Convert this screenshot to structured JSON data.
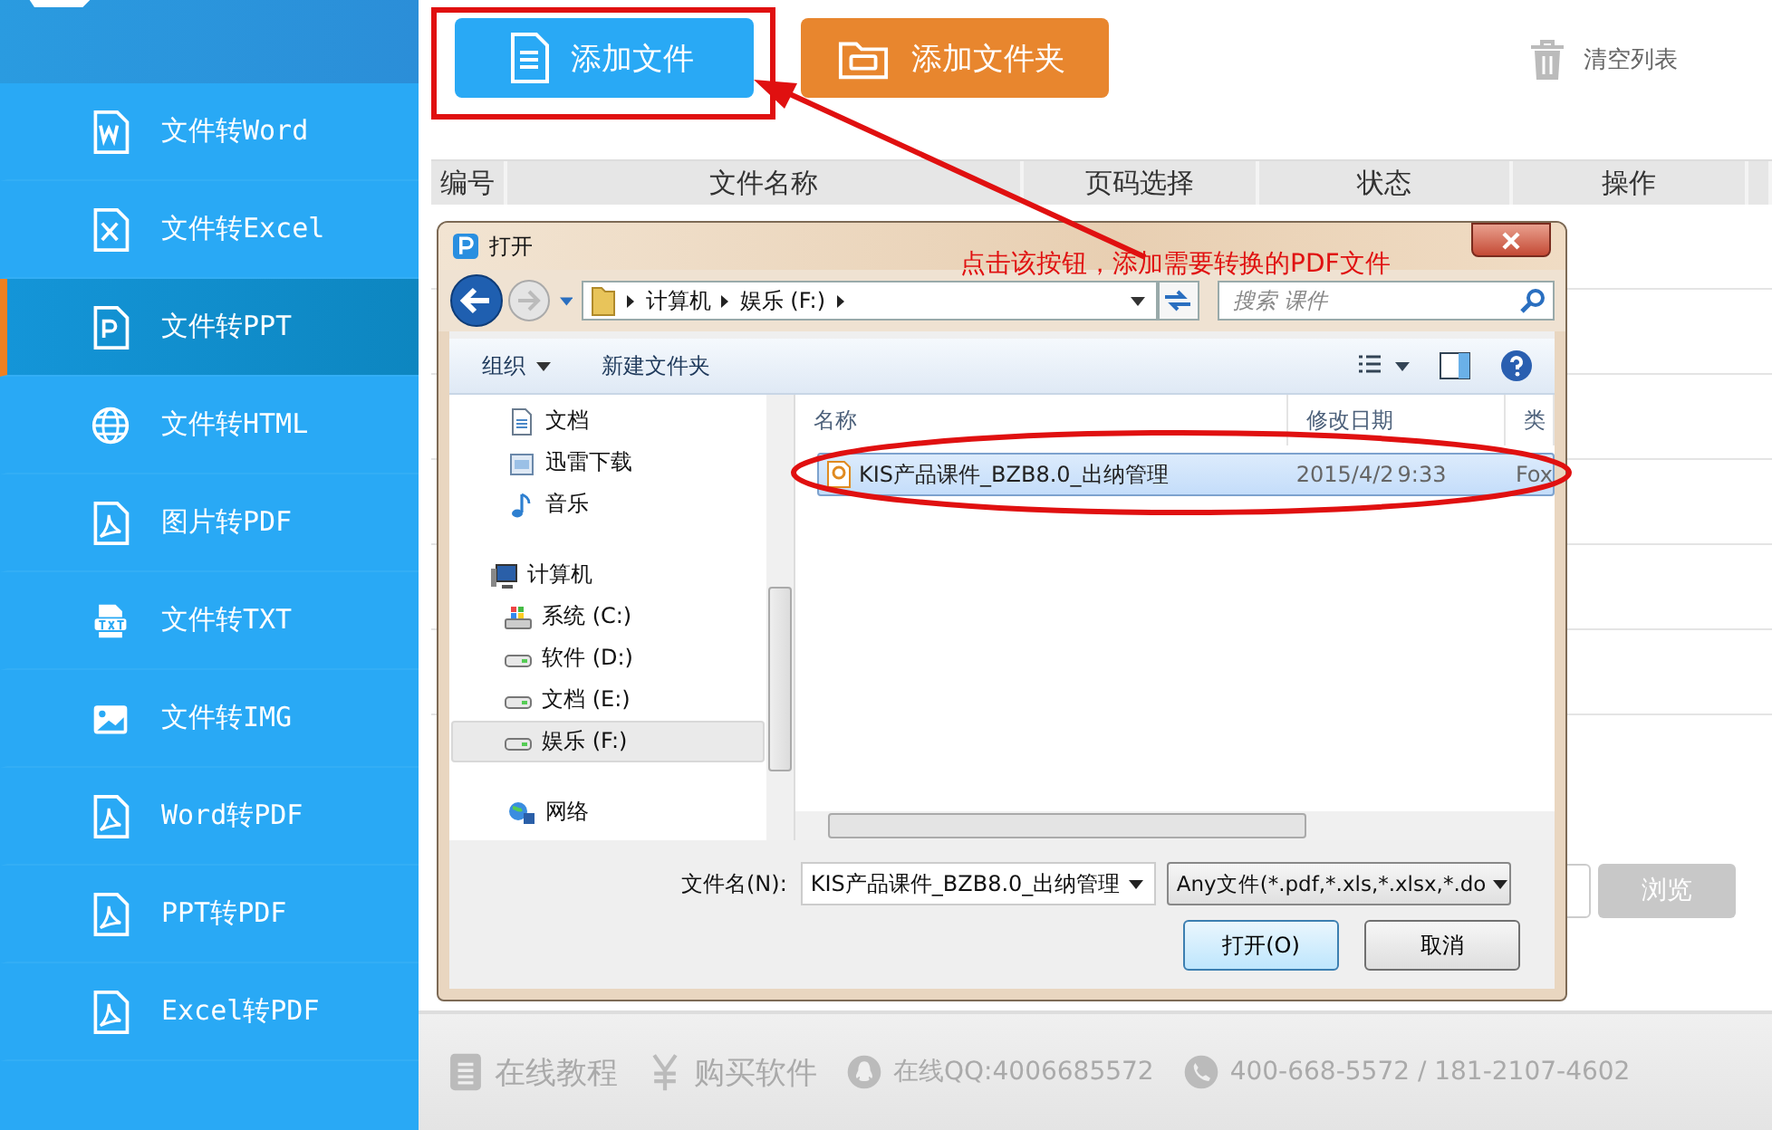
{
  "sidebar": {
    "items": [
      {
        "label": "文件转Word",
        "kind": "word",
        "selected": false
      },
      {
        "label": "文件转Excel",
        "kind": "excel",
        "selected": false
      },
      {
        "label": "文件转PPT",
        "kind": "ppt",
        "selected": true
      },
      {
        "label": "文件转HTML",
        "kind": "html",
        "selected": false
      },
      {
        "label": "图片转PDF",
        "kind": "pdf",
        "selected": false
      },
      {
        "label": "文件转TXT",
        "kind": "txt",
        "selected": false
      },
      {
        "label": "文件转IMG",
        "kind": "img",
        "selected": false
      },
      {
        "label": "Word转PDF",
        "kind": "pdf",
        "selected": false
      },
      {
        "label": "PPT转PDF",
        "kind": "pdf",
        "selected": false
      },
      {
        "label": "Excel转PDF",
        "kind": "pdf",
        "selected": false
      }
    ]
  },
  "toolbar": {
    "add_file": "添加文件",
    "add_folder": "添加文件夹",
    "clear_list": "清空列表"
  },
  "table": {
    "columns": [
      "编号",
      "文件名称",
      "页码选择",
      "状态",
      "操作"
    ]
  },
  "browse_button": "浏览",
  "footer": {
    "items": [
      {
        "kind": "tutorial",
        "label": "在线教程"
      },
      {
        "kind": "buy",
        "label": "购买软件"
      },
      {
        "kind": "qq",
        "label": "在线QQ:4006685572"
      },
      {
        "kind": "phone",
        "label": "400-668-5572 / 181-2107-4602"
      }
    ]
  },
  "annotation": "点击该按钮，添加需要转换的PDF文件",
  "dialog": {
    "title": "打开",
    "breadcrumb": [
      "计算机",
      "娱乐 (F:)"
    ],
    "search": {
      "placeholder": "搜索 课件"
    },
    "toolbar": {
      "organize": "组织",
      "new_folder": "新建文件夹"
    },
    "nav_tree": [
      {
        "label": "文档",
        "kind": "document",
        "selected": false
      },
      {
        "label": "迅雷下载",
        "kind": "download",
        "selected": false
      },
      {
        "label": "音乐",
        "kind": "music",
        "selected": false
      },
      {
        "label": "计算机",
        "kind": "computer",
        "selected": false,
        "children": [
          {
            "label": "系统 (C:)",
            "kind": "system-drive",
            "selected": false
          },
          {
            "label": "软件 (D:)",
            "kind": "drive",
            "selected": false
          },
          {
            "label": "文档 (E:)",
            "kind": "drive",
            "selected": false
          },
          {
            "label": "娱乐 (F:)",
            "kind": "drive",
            "selected": true
          }
        ]
      },
      {
        "label": "网络",
        "kind": "network",
        "selected": false
      }
    ],
    "columns": [
      "名称",
      "修改日期",
      "类"
    ],
    "files": [
      {
        "name": "KIS产品课件_BZB8.0_出纳管理",
        "date": "2015/4/2",
        "time": "9:33",
        "type": "Fox",
        "selected": true
      }
    ],
    "file_name": {
      "label": "文件名(N):",
      "value": "KIS产品课件_BZB8.0_出纳管理"
    },
    "file_type": "Any文件(*.pdf,*.xls,*.xlsx,*.do",
    "open_button": "打开(O)",
    "cancel_button": "取消"
  }
}
